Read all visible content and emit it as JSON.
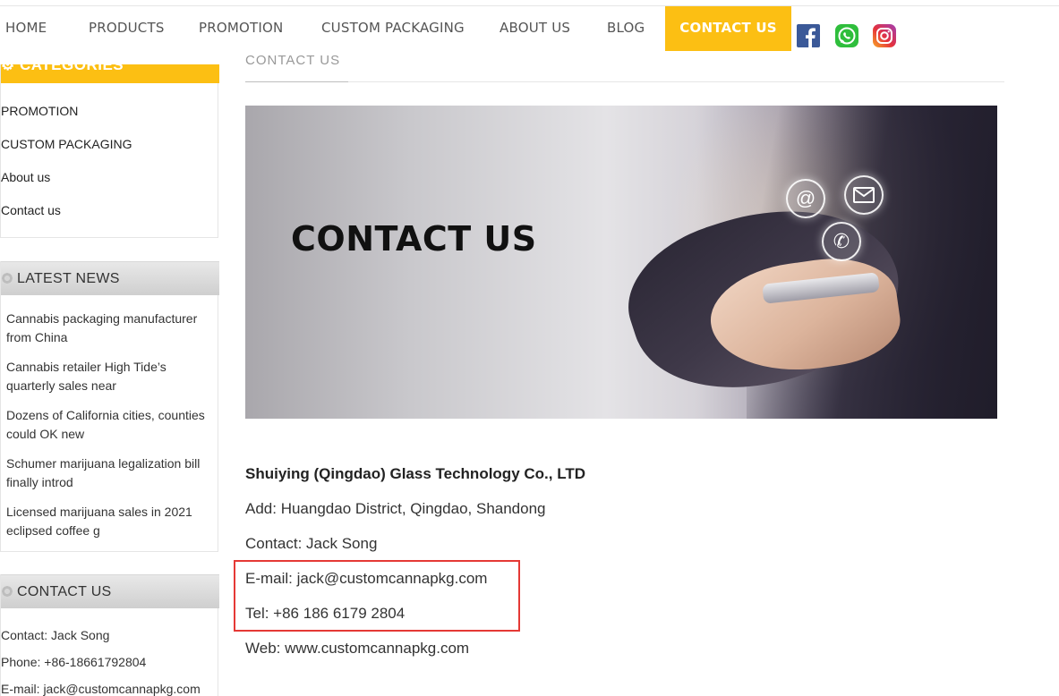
{
  "nav": {
    "items": [
      "HOME",
      "PRODUCTS",
      "PROMOTION",
      "CUSTOM PACKAGING",
      "ABOUT US",
      "BLOG",
      "CONTACT US"
    ],
    "active": "CONTACT US"
  },
  "social": [
    "facebook-icon",
    "whatsapp-icon",
    "instagram-icon"
  ],
  "sidebar": {
    "categories_title": "CATEGORIES",
    "categories": [
      "PROMOTION",
      "CUSTOM PACKAGING",
      "About us",
      "Contact us"
    ],
    "news_title": "LATEST NEWS",
    "news": [
      "Cannabis packaging manufacturer from China",
      "Cannabis retailer High Tide’s quarterly sales near",
      "Dozens of California cities, counties could OK new",
      "Schumer marijuana legalization bill finally introd",
      "Licensed marijuana sales in 2021 eclipsed coffee g"
    ],
    "contact_title": "CONTACT US",
    "contact": [
      "Contact: Jack Song",
      "Phone: +86-18661792804",
      "E-mail: jack@customcannapkg.com"
    ]
  },
  "main": {
    "crumb": "CONTACT US",
    "banner_title": "CONTACT US",
    "company": "Shuiying (Qingdao) Glass Technology Co., LTD",
    "address": "Add: Huangdao District, Qingdao, Shandong",
    "contact": "Contact: Jack Song",
    "email": "E-mail: jack@customcannapkg.com",
    "tel": "Tel: +86 186 6179 2804",
    "web": "Web: www.customcannapkg.com"
  },
  "colors": {
    "accent": "#fcbf13",
    "highlight_border": "#e53935"
  }
}
